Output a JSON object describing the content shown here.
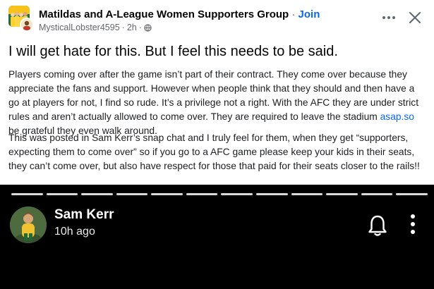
{
  "header": {
    "group_name": "Matildas and A-League Women Supporters Group",
    "separator": "·",
    "join_label": "Join",
    "author": "MysticalLobster4595",
    "time": "2h",
    "meta_separator": "·",
    "icons": {
      "group_avatar": "group-avatar-image",
      "author_avatar": "user-avatar-image",
      "audience": "globe-icon",
      "more": "more-icon",
      "close": "close-icon"
    }
  },
  "post": {
    "title": "I will get hate for this. But I feel this needs to be said.",
    "paragraph1_before_link": "Players coming over after the game isn’t part of their contract. They come over because they appreciate the fans and support. However when people think that they should and then have a go at players for not, I find so rude. It’s a privilege not a right. With the AFC they are under strict rules and aren’t actually allowed to come over. They are required to leave the stadium ",
    "paragraph1_link": "asap.so",
    "paragraph1_after_link": " be grateful they even walk around.",
    "paragraph2": "This was posted in Sam Kerr’s snap chat and I truly feel for them, when they get “supporters, expecting them to come over” so if you go to a AFC game please keep your kids in their seats, they can’t come over, but also have respect for those that paid for their seats closer to the rails!!"
  },
  "snap": {
    "segments": 12,
    "name": "Sam Kerr",
    "time": "10h ago",
    "icons": {
      "avatar": "snap-avatar-image",
      "bell": "bell-icon",
      "menu": "vertical-more-icon"
    },
    "background_color": "#000000"
  },
  "colors": {
    "link": "#0866ff",
    "secondary_text": "#65676b",
    "primary_text": "#050505"
  }
}
